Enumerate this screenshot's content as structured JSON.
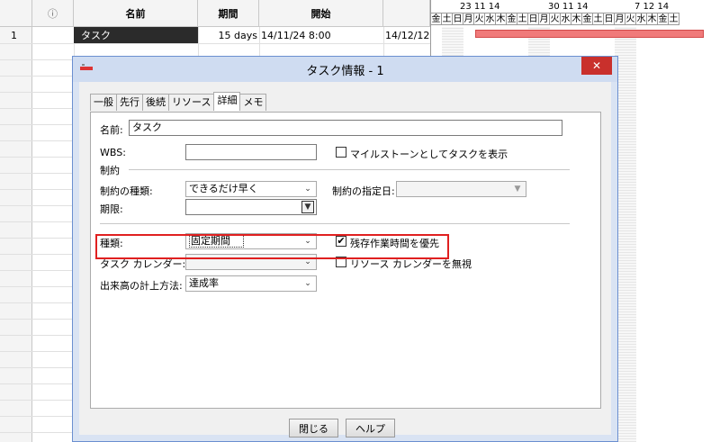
{
  "grid": {
    "headers": {
      "indicator": "ⓘ",
      "name": "名前",
      "duration": "期間",
      "start": "開始"
    },
    "rows": [
      {
        "num": "1",
        "name": "タスク",
        "duration": "15 days",
        "start": "14/11/24 8:00",
        "finish": "14/12/12"
      }
    ]
  },
  "gantt": {
    "weeks": [
      "23 11 14",
      "30 11 14",
      "7 12 14"
    ],
    "days": [
      "金",
      "土",
      "日",
      "月",
      "火",
      "水",
      "木",
      "金",
      "土",
      "日",
      "月",
      "火",
      "水",
      "木",
      "金",
      "土",
      "日",
      "月",
      "火",
      "水",
      "木",
      "金",
      "土"
    ],
    "bar_color": "#f07a7a"
  },
  "dialog": {
    "title": "タスク情報 - 1",
    "close_label": "✕",
    "tabs": [
      "一般",
      "先行",
      "後続",
      "リソース",
      "詳細",
      "メモ"
    ],
    "active_tab": "詳細",
    "name_label": "名前:",
    "name_value": "タスク",
    "wbs_label": "WBS:",
    "wbs_value": "",
    "milestone_label": "マイルストーンとしてタスクを表示",
    "constraint_section": "制約",
    "constraint_type_label": "制約の種類:",
    "constraint_type_value": "できるだけ早く",
    "constraint_date_label": "制約の指定日:",
    "constraint_date_value": "",
    "deadline_label": "期限:",
    "deadline_value": "",
    "type_label": "種類:",
    "type_value": "固定期間",
    "effort_driven_label": "残存作業時間を優先",
    "effort_driven_checked": "✔",
    "task_calendar_label": "タスク カレンダー:",
    "task_calendar_value": "",
    "ignore_resource_calendar_label": "リソース カレンダーを無視",
    "earned_value_label": "出来高の計上方法:",
    "earned_value_value": "達成率",
    "close_button": "閉じる",
    "help_button": "ヘルプ",
    "accent_color": "#e02020"
  }
}
